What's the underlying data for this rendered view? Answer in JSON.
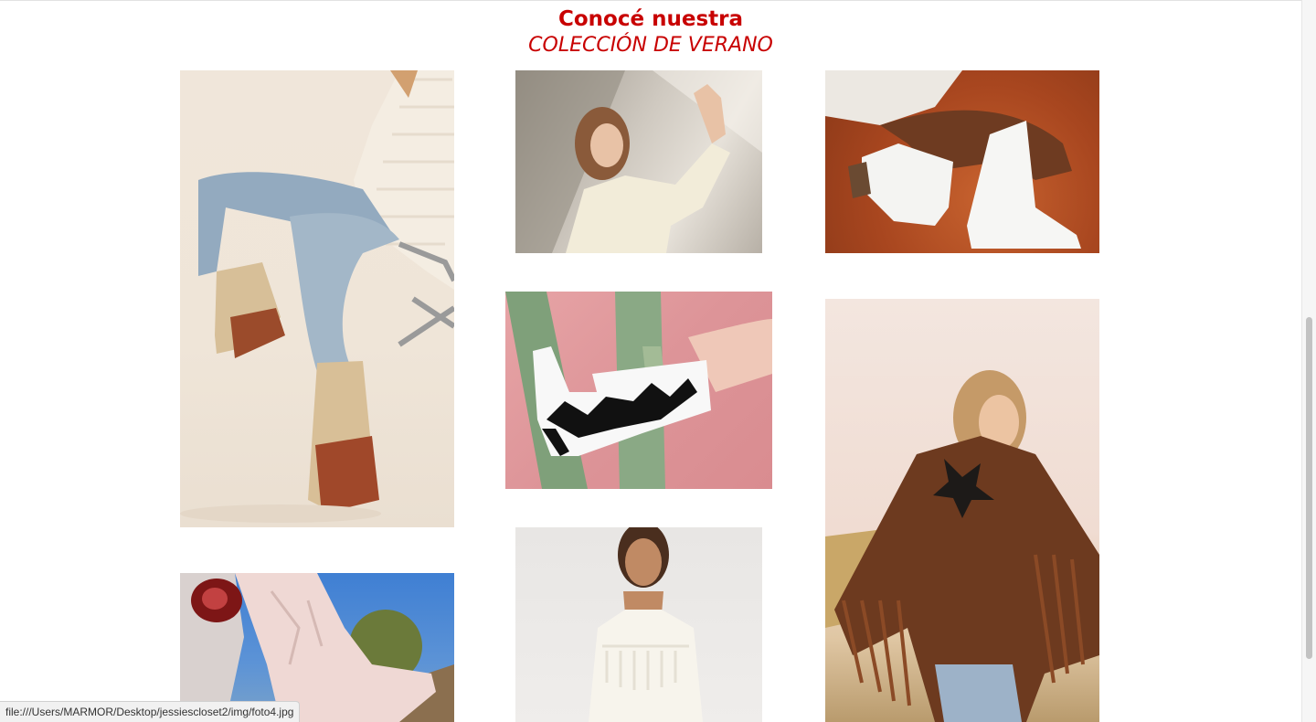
{
  "heading": {
    "title": "Conocé nuestra",
    "subtitle": "COLECCIÓN DE VERANO"
  },
  "colors": {
    "accent": "#c80000"
  },
  "status_bar": {
    "text": "file:///Users/MARMOR/Desktop/jessiescloset2/img/foto4.jpg"
  }
}
